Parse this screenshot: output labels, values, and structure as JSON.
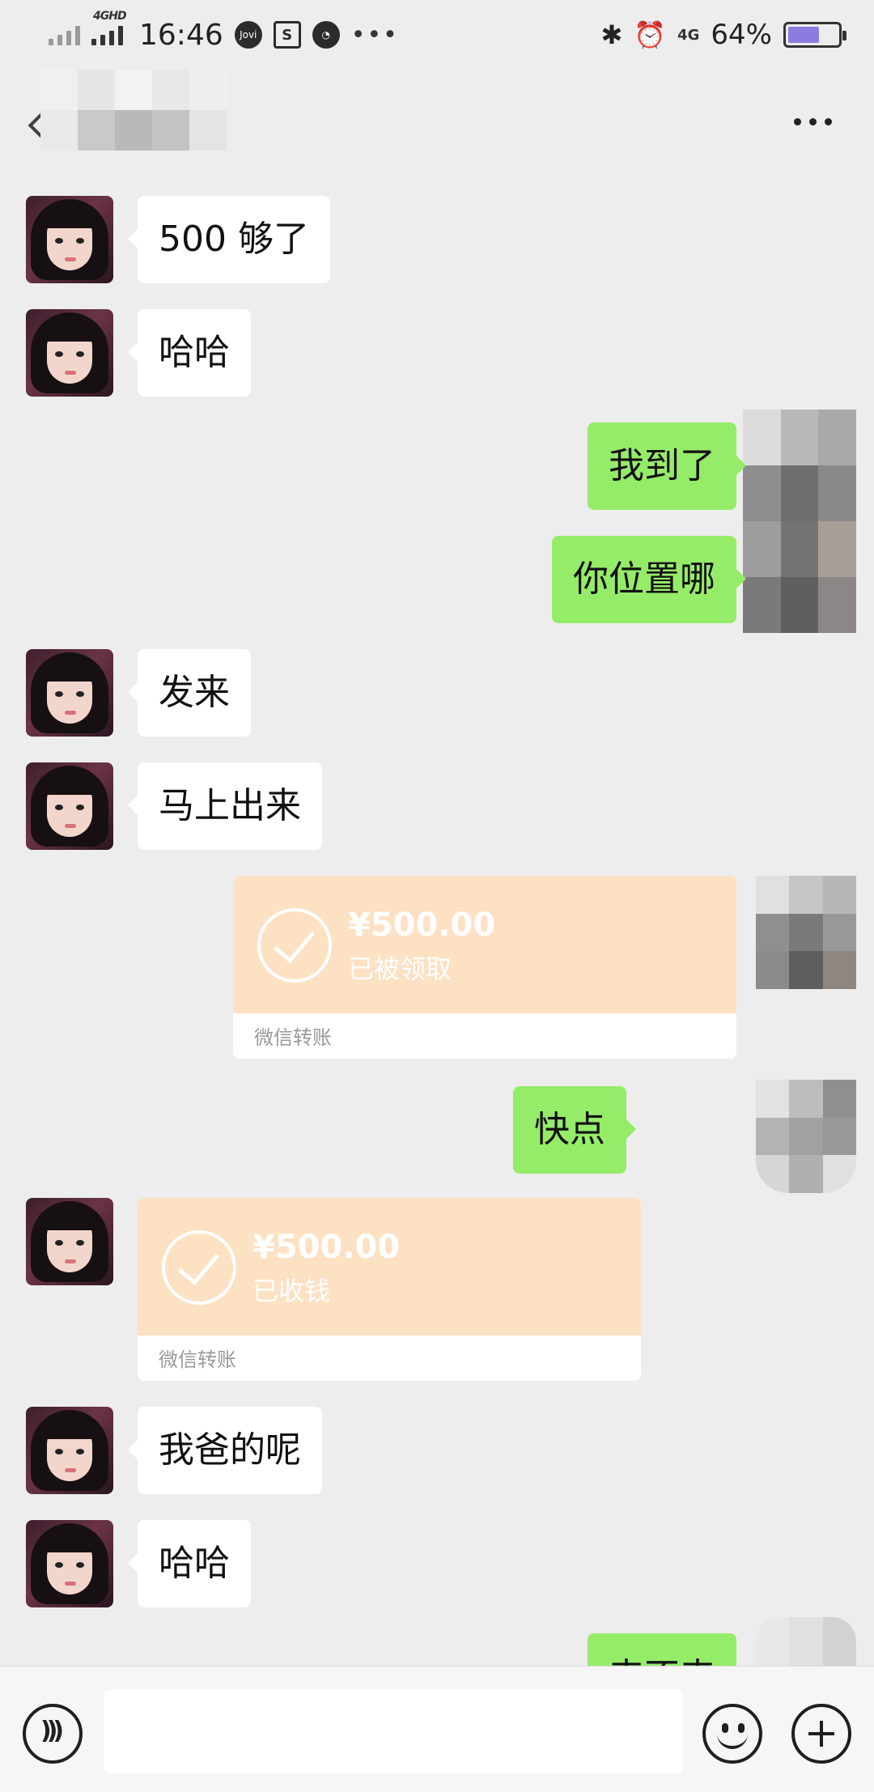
{
  "status_bar": {
    "network_tag": "4GHD",
    "time": "16:46",
    "jovi_label": "Jovi",
    "network_right": "4G",
    "battery_percent": "64%",
    "battery_level": 0.64
  },
  "header": {
    "title_obscured": true
  },
  "messages": [
    {
      "side": "left",
      "type": "text",
      "text": "500 够了"
    },
    {
      "side": "left",
      "type": "text",
      "text": "哈哈"
    },
    {
      "side": "right",
      "type": "text",
      "text": "我到了"
    },
    {
      "side": "right",
      "type": "text",
      "text": "你位置哪"
    },
    {
      "side": "left",
      "type": "text",
      "text": "发来"
    },
    {
      "side": "left",
      "type": "text",
      "text": "马上出来"
    },
    {
      "side": "right",
      "type": "transfer",
      "amount": "¥500.00",
      "status": "已被领取",
      "label": "微信转账"
    },
    {
      "side": "right",
      "type": "text",
      "text": "快点"
    },
    {
      "side": "left",
      "type": "transfer",
      "amount": "¥500.00",
      "status": "已收钱",
      "label": "微信转账"
    },
    {
      "side": "left",
      "type": "text",
      "text": "我爸的呢"
    },
    {
      "side": "left",
      "type": "text",
      "text": "哈哈"
    },
    {
      "side": "right",
      "type": "text",
      "text": "来不来"
    }
  ],
  "input_bar": {
    "placeholder": ""
  },
  "colors": {
    "background": "#ededed",
    "self_bubble": "#95ec69",
    "other_bubble": "#ffffff",
    "transfer_card": "#fde1c3"
  }
}
